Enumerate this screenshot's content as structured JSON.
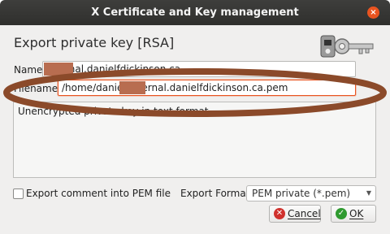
{
  "window": {
    "title": "X Certificate and Key management",
    "close_glyph": "×"
  },
  "heading": "Export private key [RSA]",
  "name_field": {
    "label": "Name",
    "value": "internal.danielfdickinson.ca"
  },
  "filename_field": {
    "label": "Filename",
    "value": "/home/daniel/internal.danielfdickinson.ca.pem"
  },
  "comment": "Unencrypted private key in text format",
  "export_comment": {
    "label": "Export comment into PEM file",
    "checked": false
  },
  "export_format": {
    "label": "Export Format",
    "selected": "PEM private (*.pem)"
  },
  "buttons": {
    "cancel": "Cancel",
    "ok": "OK"
  },
  "icons": {
    "cancel": "cancel-icon",
    "ok": "check-icon",
    "key": "key-icon",
    "close": "close-icon"
  },
  "colors": {
    "accent": "#e95420",
    "titlebar": "#33322f",
    "annotation": "#8b4a2a",
    "ok_green": "#2f9a2f",
    "cancel_red": "#d0312d"
  }
}
